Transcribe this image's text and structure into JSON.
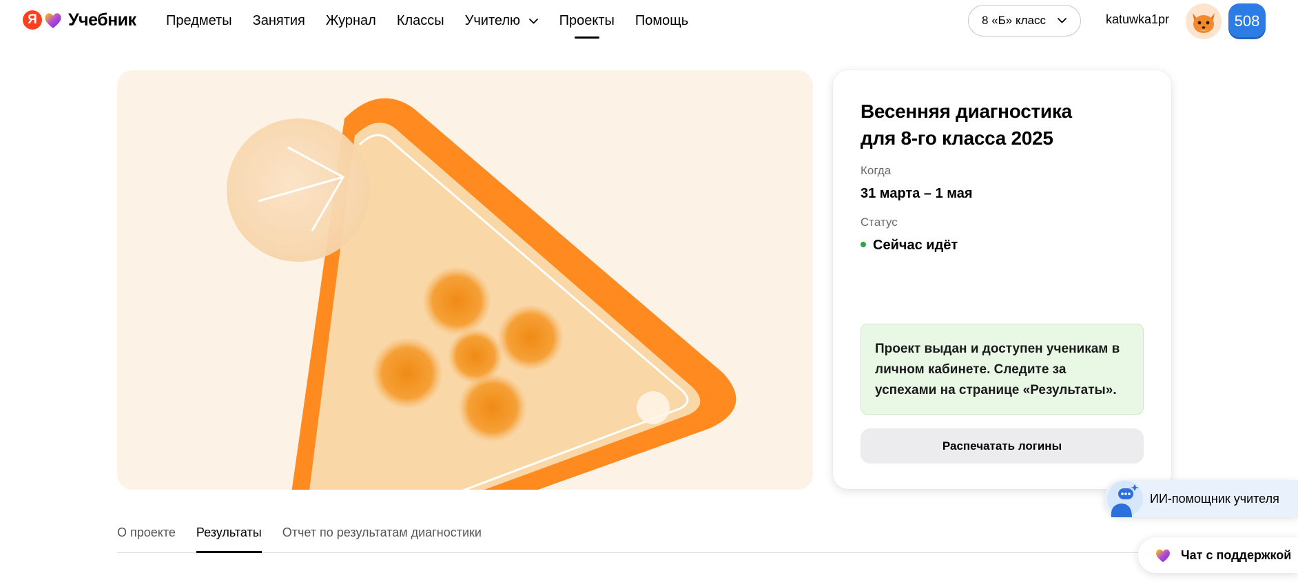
{
  "header": {
    "logo_text": "Учебник",
    "logo_ya": "Я",
    "nav": [
      {
        "label": "Предметы"
      },
      {
        "label": "Занятия"
      },
      {
        "label": "Журнал"
      },
      {
        "label": "Классы"
      },
      {
        "label": "Учителю"
      },
      {
        "label": "Проекты"
      },
      {
        "label": "Помощь"
      }
    ],
    "active_nav": "Проекты",
    "class_selector": "8 «Б» класс",
    "username": "katuwka1pr",
    "avatar_icon": "fox-avatar-icon",
    "points": "508"
  },
  "project": {
    "title_line1": "Весенняя диагностика",
    "title_line2": "для 8-го класса 2025",
    "when_label": "Когда",
    "when_value": "31 марта – 1 мая",
    "status_label": "Статус",
    "status_value": "Сейчас идёт",
    "status_color": "#27a844",
    "notice": "Проект выдан и доступен ученикам в личном кабинете. Следите за успехами на странице «Результаты».",
    "print_button": "Распечатать логины"
  },
  "tabs": [
    {
      "label": "О проекте"
    },
    {
      "label": "Результаты"
    },
    {
      "label": "Отчет по результатам диагностики"
    }
  ],
  "active_tab": "Результаты",
  "floating": {
    "ai_helper": "ИИ-помощник учителя",
    "support_chat": "Чат с поддержкой"
  },
  "colors": {
    "accent_orange": "#ff8a1f",
    "hero_bg": "#fdf2e6",
    "points_badge": "#2d7be5",
    "notice_bg": "#e9f8e5"
  }
}
